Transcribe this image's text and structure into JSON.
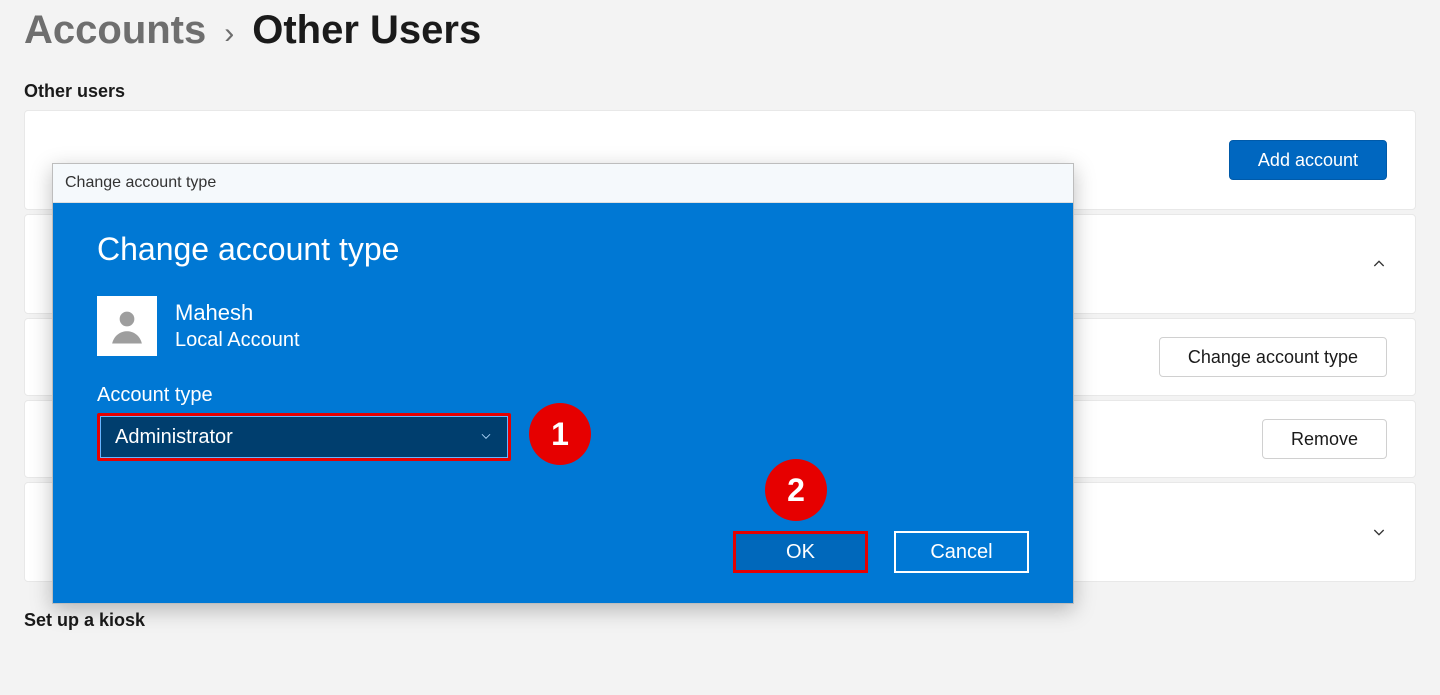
{
  "breadcrumb": {
    "parent": "Accounts",
    "separator": "›",
    "current": "Other Users"
  },
  "sections": {
    "other_users_label": "Other users",
    "kiosk_label": "Set up a kiosk"
  },
  "cards": {
    "add_account_btn": "Add account",
    "change_type_btn": "Change account type",
    "remove_btn": "Remove"
  },
  "dialog": {
    "titlebar": "Change account type",
    "heading": "Change account type",
    "user_name": "Mahesh",
    "user_kind": "Local Account",
    "field_label": "Account type",
    "select_value": "Administrator",
    "ok": "OK",
    "cancel": "Cancel"
  },
  "annotations": {
    "one": "1",
    "two": "2"
  }
}
